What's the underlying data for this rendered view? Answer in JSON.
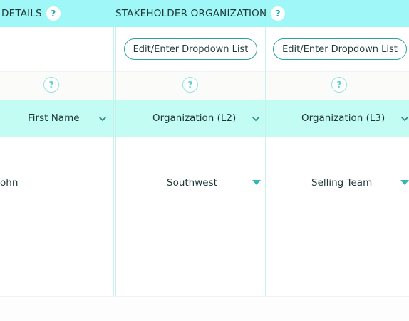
{
  "sections": {
    "details": {
      "title": "DETAILS",
      "help": "?"
    },
    "stakeholder_org": {
      "title": "STAKEHOLDER ORGANIZATION",
      "help": "?"
    }
  },
  "dropdown_buttons": {
    "l2": {
      "label": "Edit/Enter Dropdown List"
    },
    "l3": {
      "label": "Edit/Enter Dropdown List"
    }
  },
  "help_row": {
    "first_name": "?",
    "org_l2": "?",
    "org_l3": "?"
  },
  "columns": {
    "first_name": {
      "label": "First Name",
      "icon": "chevron-down-icon"
    },
    "org_l2": {
      "label": "Organization (L2)",
      "icon": "chevron-down-icon"
    },
    "org_l3": {
      "label": "Organization (L3)",
      "icon": "chevron-down-icon"
    }
  },
  "row": {
    "first_name": "ohn",
    "org_l2": {
      "value": "Southwest",
      "icon": "caret-down-icon"
    },
    "org_l3": {
      "value": "Selling Team",
      "icon": "caret-down-icon"
    }
  },
  "colors": {
    "section_bar": "#a0f7f7",
    "header_row": "#c2fcf3",
    "accent": "#2aa39c",
    "caret": "#34b7b0"
  }
}
